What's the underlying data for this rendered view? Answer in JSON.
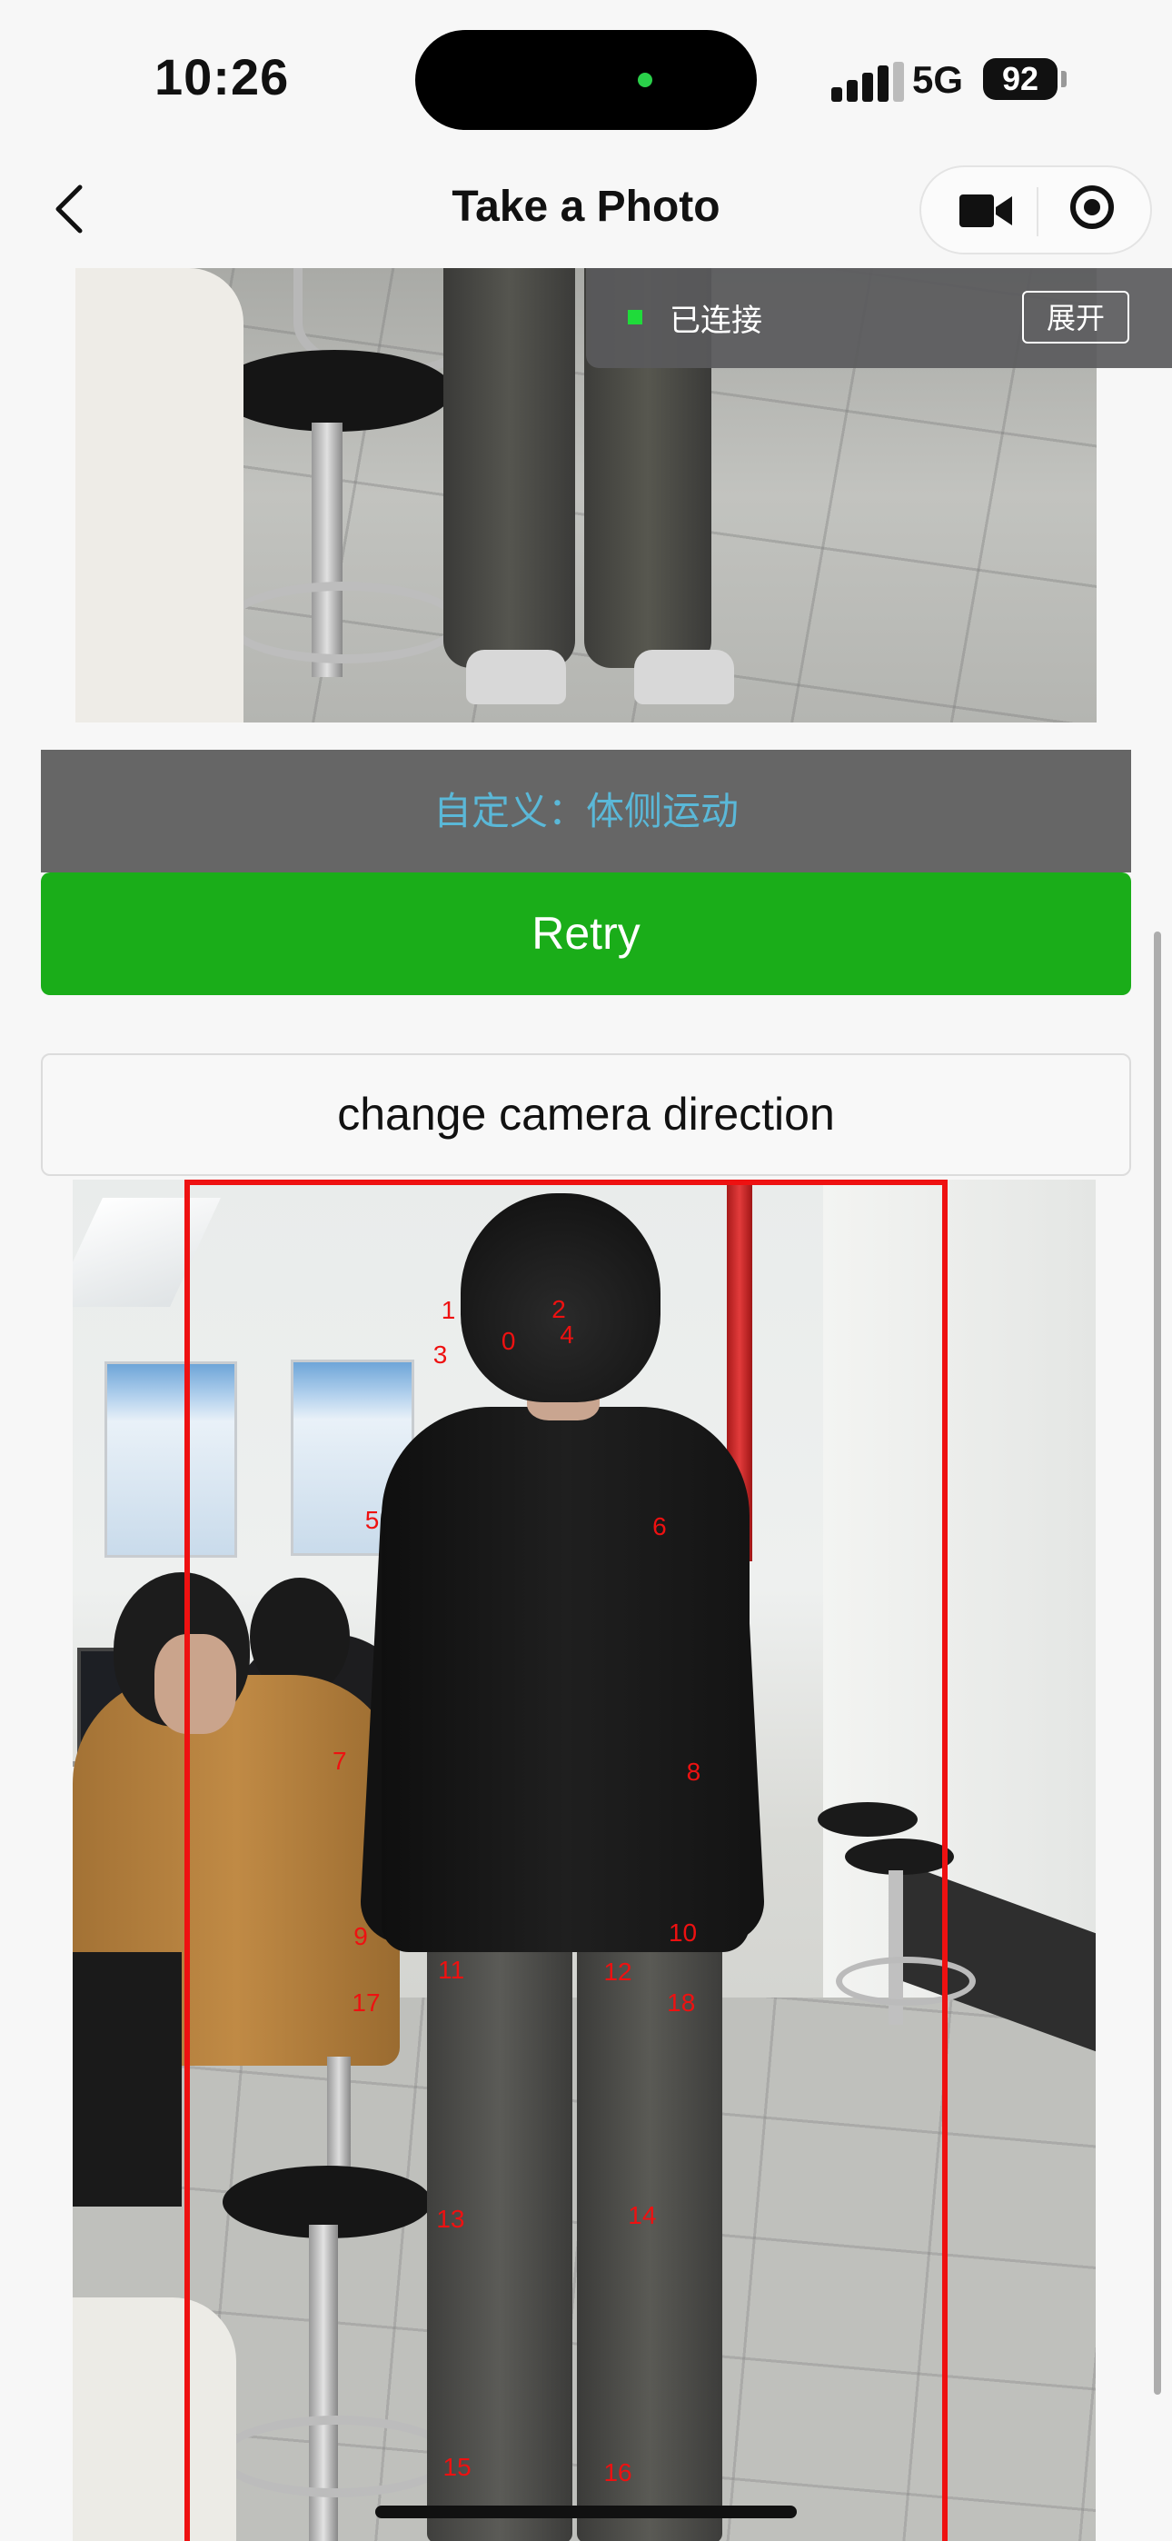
{
  "status": {
    "time": "10:26",
    "network": "5G",
    "battery": "92"
  },
  "nav": {
    "title": "Take a Photo",
    "back_icon": "chevron-left-icon",
    "video_icon": "video-camera-icon",
    "record_icon": "record-icon"
  },
  "connection": {
    "status": "已连接",
    "expand_label": "展开"
  },
  "custom_label": "自定义：体侧运动",
  "buttons": {
    "retry": "Retry",
    "change_direction": "change camera direction"
  },
  "keypoints": [
    "0",
    "1",
    "2",
    "3",
    "4",
    "5",
    "6",
    "7",
    "8",
    "9",
    "10",
    "11",
    "12",
    "13",
    "14",
    "15",
    "16",
    "17",
    "18"
  ],
  "colors": {
    "retry_green": "#1aad19",
    "keypoint_red": "#ee1111",
    "custom_bar_bg": "#666666",
    "custom_text": "#5ab8d8"
  }
}
